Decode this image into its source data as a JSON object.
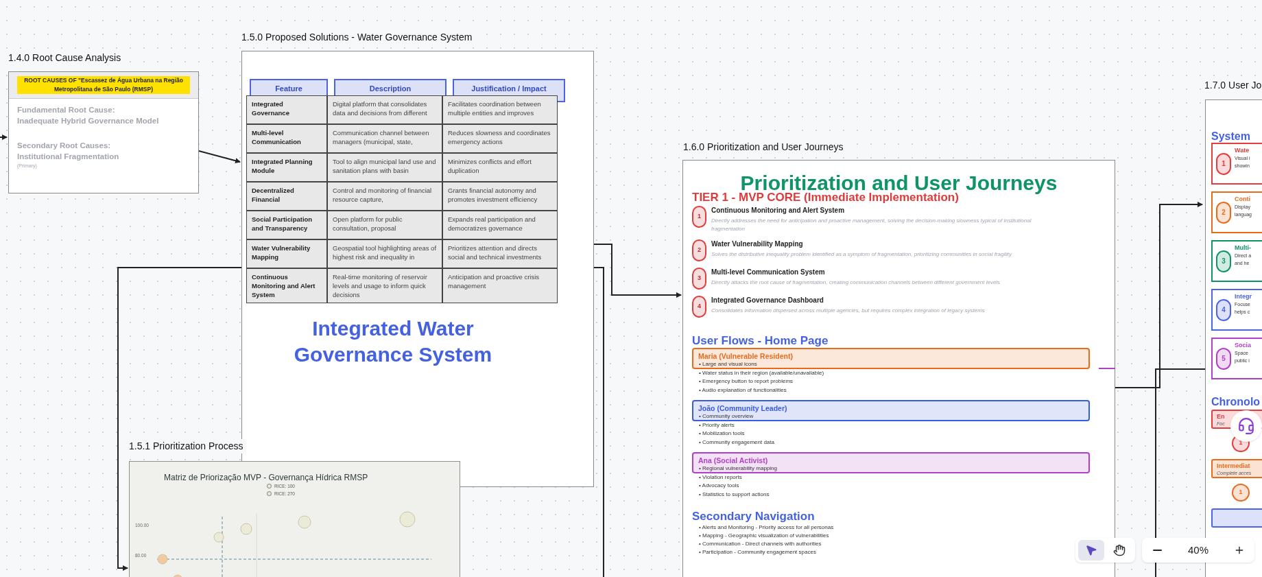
{
  "root_cause": {
    "label": "1.4.0 Root Cause Analysis",
    "header": "ROOT CAUSES OF \"Escassez de Água Urbana na Região Metropolitana de São Paulo (RMSP)",
    "fundamental_label": "Fundamental Root Cause:",
    "fundamental": "Inadequate Hybrid Governance Model",
    "secondary_label": "Secondary Root Causes:",
    "secondary": "Institutional Fragmentation",
    "note": "(Primary)"
  },
  "proposed_solutions": {
    "label": "1.5.0 Proposed Solutions - Water Governance System",
    "columns": [
      "Feature",
      "Description",
      "Justification / Impact"
    ],
    "rows": [
      {
        "feature": "Integrated Governance",
        "description": "Digital platform that consolidates data and decisions from different",
        "justification": "Facilitates coordination between multiple entities and improves"
      },
      {
        "feature": "Multi-level Communication",
        "description": "Communication channel between managers (municipal, state,",
        "justification": "Reduces slowness and coordinates emergency actions"
      },
      {
        "feature": "Integrated Planning Module",
        "description": "Tool to align municipal land use and sanitation plans with basin",
        "justification": "Minimizes conflicts and effort duplication"
      },
      {
        "feature": "Decentralized Financial",
        "description": "Control and monitoring of financial resource capture,",
        "justification": "Grants financial autonomy and promotes investment efficiency"
      },
      {
        "feature": "Social Participation and Transparency",
        "description": "Open platform for public consultation, proposal",
        "justification": "Expands real participation and democratizes governance"
      },
      {
        "feature": "Water Vulnerability Mapping",
        "description": "Geospatial tool highlighting areas of highest risk and inequality in",
        "justification": "Prioritizes attention and directs social and technical investments"
      },
      {
        "feature": "Continuous Monitoring and Alert System",
        "description": "Real-time monitoring of reservoir levels and usage to inform quick decisions",
        "justification": "Anticipation and proactive crisis management"
      }
    ],
    "headline": "Integrated Water Governance System"
  },
  "prioritization_process": {
    "label": "1.5.1 Prioritization Process",
    "chart_title": "Matriz de Priorização MVP - Governança Hídrica RMSP",
    "legend": [
      "RICE: 100",
      "RICE: 270"
    ],
    "y_ticks": [
      "100.00",
      "80.00"
    ]
  },
  "prioritization_journeys": {
    "label": "1.6.0 Prioritization and User Journeys",
    "title": "Prioritization and User Journeys",
    "tier_title": "TIER 1 - MVP CORE (Immediate Implementation)",
    "tier_items": [
      {
        "number": "1",
        "title": "Continuous Monitoring and Alert System",
        "description": "Directly addresses the need for anticipation and proactive management, solving the decision-making slowness typical of institutional fragmentation"
      },
      {
        "number": "2",
        "title": "Water Vulnerability Mapping",
        "description": "Solves the distributive inequality problem identified as a symptom of fragmentation, prioritizing communities in social fragility"
      },
      {
        "number": "3",
        "title": "Multi-level Communication System",
        "description": "Directly attacks the root cause of fragmentation, creating communication channels between different government levels"
      },
      {
        "number": "4",
        "title": "Integrated Governance Dashboard",
        "description": "Consolidates information dispersed across multiple agencies, but requires complex integration of legacy systems"
      }
    ],
    "flows_title": "User Flows - Home Page",
    "personas": [
      {
        "name": "Maria (Vulnerable Resident)",
        "color": "#ea6a1c",
        "bullets": [
          "• Large and visual icons",
          "• Water status in their region (available/unavailable)",
          "• Emergency button to report problems",
          "• Audio explanation of functionalities"
        ]
      },
      {
        "name": "João (Community Leader)",
        "color": "#3b5be0",
        "bullets": [
          "• Community overview",
          "• Priority alerts",
          "• Mobilization tools",
          "• Community engagement data"
        ]
      },
      {
        "name": "Ana (Social Activist)",
        "color": "#b23fc7",
        "bullets": [
          "• Regional vulnerability mapping",
          "• Violation reports",
          "• Advocacy tools",
          "• Statistics to support actions"
        ]
      }
    ],
    "secondary_title": "Secondary Navigation",
    "secondary_items": [
      "• Alerts and Monitoring - Priority access for all personas",
      "• Mapping - Geographic visualization of vulnerabilities",
      "• Communication - Direct channels with authorities",
      "• Participation - Community engagement spaces"
    ]
  },
  "user_journey": {
    "label": "1.7.0 User Jo",
    "section_title": "System",
    "features": [
      {
        "number": "1",
        "title": "Wate",
        "lines": [
          "Visual i",
          "showin"
        ],
        "color": "#e23c3c"
      },
      {
        "number": "2",
        "title": "Conti",
        "lines": [
          "Display",
          "languag"
        ],
        "color": "#ea6a1c"
      },
      {
        "number": "3",
        "title": "Multi-",
        "lines": [
          "Direct a",
          "and he"
        ],
        "color": "#0f9466"
      },
      {
        "number": "4",
        "title": "Integr",
        "lines": [
          "Focuse",
          "helps c"
        ],
        "color": "#4a63e7"
      },
      {
        "number": "5",
        "title": "Socia",
        "lines": [
          "Space",
          "public i"
        ],
        "color": "#b23fc7"
      }
    ],
    "chronology_title": "Chronolo",
    "phases": [
      {
        "title": "En",
        "subtitle": "Foc",
        "number": "1",
        "color": "#e23c3c"
      },
      {
        "title": "Intermediat",
        "subtitle": "Complete acces",
        "number": "1",
        "color": "#ea6a1c"
      },
      {
        "color": "#4a63e7"
      }
    ]
  },
  "toolbar": {
    "tools": [
      {
        "kind": "select",
        "selected": true
      },
      {
        "kind": "hand",
        "selected": false
      }
    ]
  },
  "zoom": {
    "value": "40%"
  }
}
